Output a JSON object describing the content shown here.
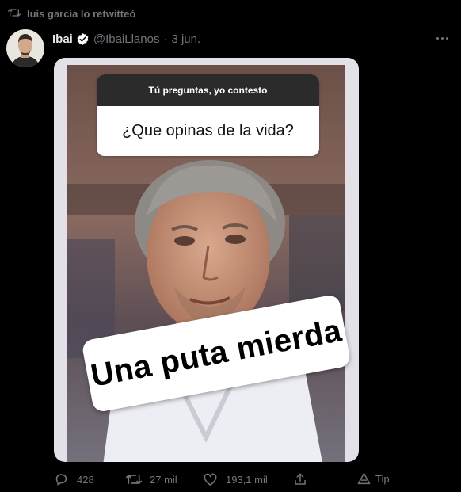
{
  "retweet": {
    "label": "luis garcia lo retwitteó"
  },
  "tweet": {
    "author_name": "Ibai",
    "author_handle": "@IbaiLlanos",
    "separator": "·",
    "date": "3 jun."
  },
  "media": {
    "question_header": "Tú preguntas, yo contesto",
    "question_text": "¿Que opinas de la vida?",
    "answer_sticker": "Una puta mierda"
  },
  "actions": {
    "replies": "428",
    "retweets": "27 mil",
    "likes": "193,1 mil",
    "tip_label": "Tip"
  },
  "colors": {
    "background": "#000000",
    "muted_text": "#71767b",
    "verified_badge": "#ffffff"
  },
  "icons": [
    "retweet-icon",
    "verified-icon",
    "more-icon",
    "reply-icon",
    "retweet-icon",
    "like-icon",
    "share-icon",
    "tip-icon"
  ]
}
